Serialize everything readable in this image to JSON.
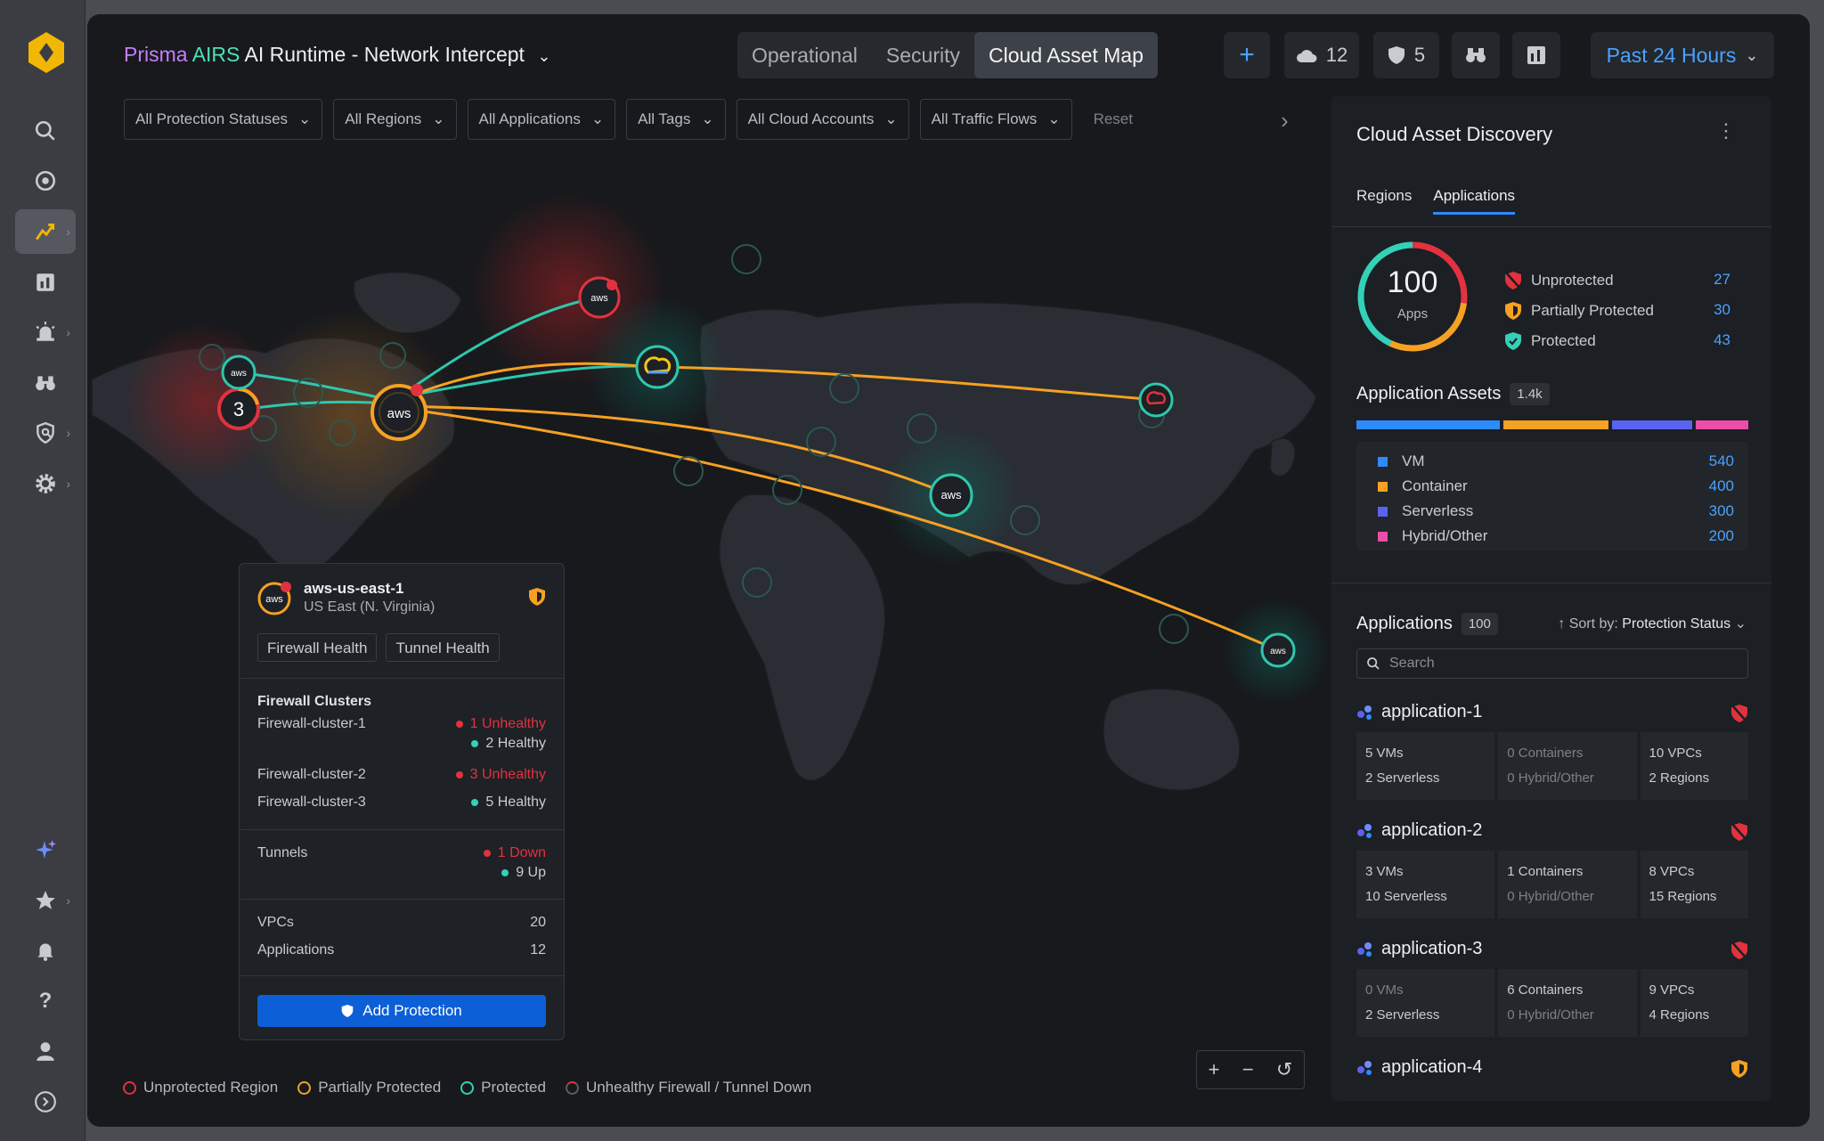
{
  "header": {
    "title_prefix_1": "Prisma",
    "title_prefix_2": "AIRS",
    "title_rest": "AI Runtime - Network Intercept",
    "tabs": [
      "Operational",
      "Security",
      "Cloud Asset Map"
    ],
    "cloud_count": "12",
    "shield_count": "5",
    "time_range": "Past 24 Hours"
  },
  "filters": [
    "All Protection Statuses",
    "All Regions",
    "All Applications",
    "All Tags",
    "All Cloud Accounts",
    "All Traffic Flows"
  ],
  "reset_label": "Reset",
  "map": {
    "cluster_count": "3",
    "markers": {
      "aws": "aws"
    }
  },
  "popup": {
    "name": "aws-us-east-1",
    "region": "US East (N. Virginia)",
    "tabs": [
      "Firewall Health",
      "Tunnel Health"
    ],
    "clusters_title": "Firewall Clusters",
    "clusters": [
      {
        "name": "Firewall-cluster-1",
        "lines": [
          {
            "status": "red",
            "text": "1 Unhealthy"
          },
          {
            "status": "teal",
            "text": "2 Healthy"
          }
        ]
      },
      {
        "name": "Firewall-cluster-2",
        "lines": [
          {
            "status": "red",
            "text": "3 Unhealthy"
          }
        ]
      },
      {
        "name": "Firewall-cluster-3",
        "lines": [
          {
            "status": "teal",
            "text": "5 Healthy"
          }
        ]
      }
    ],
    "tunnels_label": "Tunnels",
    "tunnel_down": "1 Down",
    "tunnel_up": "9 Up",
    "vpcs_label": "VPCs",
    "vpcs": "20",
    "apps_label": "Applications",
    "apps": "12",
    "add_button": "Add Protection"
  },
  "legend": [
    "Unprotected Region",
    "Partially Protected",
    "Protected",
    "Unhealthy Firewall / Tunnel Down"
  ],
  "colors": {
    "unprotected": "#e2323f",
    "partial": "#f5a123",
    "protected": "#33d1b8",
    "accent": "#2e8bff"
  },
  "panel": {
    "title": "Cloud Asset Discovery",
    "tabs": [
      "Regions",
      "Applications"
    ],
    "donut": {
      "total": "100",
      "label": "Apps"
    },
    "statuses": [
      {
        "label": "Unprotected",
        "value": "27"
      },
      {
        "label": "Partially Protected",
        "value": "30"
      },
      {
        "label": "Protected",
        "value": "43"
      }
    ],
    "assets_title": "Application Assets",
    "assets_badge": "1.4k",
    "assets": [
      {
        "label": "VM",
        "value": "540",
        "color": "#2e8bff"
      },
      {
        "label": "Container",
        "value": "400",
        "color": "#f5a123"
      },
      {
        "label": "Serverless",
        "value": "300",
        "color": "#5a63f0"
      },
      {
        "label": "Hybrid/Other",
        "value": "200",
        "color": "#ea4ea8"
      }
    ],
    "apps_title": "Applications",
    "apps_badge": "100",
    "sort_label": "Sort by:",
    "sort_value": "Protection Status",
    "search_placeholder": "Search",
    "apps": [
      {
        "name": "application-1",
        "status": "unprotected",
        "c1a": "5 VMs",
        "c1b": "2 Serverless",
        "c2a": "0 Containers",
        "c2b": "0 Hybrid/Other",
        "c3a": "10 VPCs",
        "c3b": "2 Regions"
      },
      {
        "name": "application-2",
        "status": "unprotected",
        "c1a": "3 VMs",
        "c1b": "10 Serverless",
        "c2a": "1 Containers",
        "c2b": "0 Hybrid/Other",
        "c3a": "8 VPCs",
        "c3b": "15 Regions"
      },
      {
        "name": "application-3",
        "status": "unprotected",
        "c1a": "0 VMs",
        "c1b": "2 Serverless",
        "c2a": "6 Containers",
        "c2b": "0 Hybrid/Other",
        "c3a": "9 VPCs",
        "c3b": "4 Regions"
      },
      {
        "name": "application-4",
        "status": "partial"
      }
    ]
  }
}
